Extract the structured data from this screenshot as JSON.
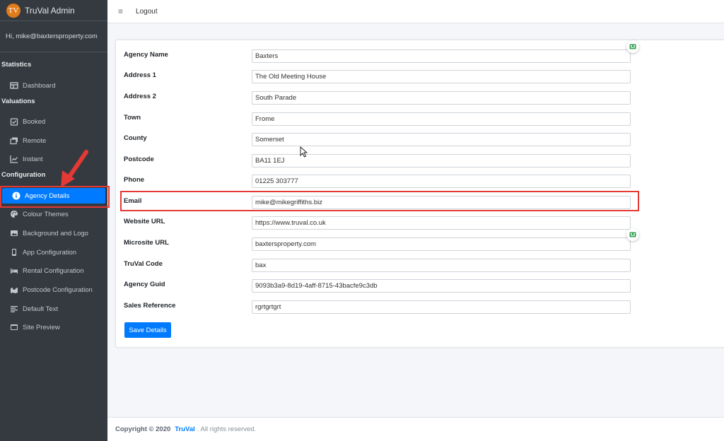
{
  "brand": {
    "logo_text": "TV",
    "title": "TruVal Admin"
  },
  "user": {
    "greeting": "Hi, mike@baxtersproperty.com"
  },
  "sidebar": {
    "headers": {
      "statistics": "Statistics",
      "valuations": "Valuations",
      "configuration": "Configuration"
    },
    "items": {
      "dashboard": "Dashboard",
      "booked": "Booked",
      "remote": "Remote",
      "instant": "Instant",
      "agency_details": "Agency Details",
      "colour_themes": "Colour Themes",
      "background_logo": "Background and Logo",
      "app_configuration": "App Configuration",
      "rental_configuration": "Rental Configuration",
      "postcode_configuration": "Postcode Configuration",
      "default_text": "Default Text",
      "site_preview": "Site Preview"
    }
  },
  "topbar": {
    "menu_icon": "≡",
    "logout": "Logout"
  },
  "form": {
    "fields": [
      {
        "label": "Agency Name",
        "value": "Baxters"
      },
      {
        "label": "Address 1",
        "value": "The Old Meeting House"
      },
      {
        "label": "Address 2",
        "value": "South Parade"
      },
      {
        "label": "Town",
        "value": "Frome"
      },
      {
        "label": "County",
        "value": "Somerset"
      },
      {
        "label": "Postcode",
        "value": "BA11 1EJ"
      },
      {
        "label": "Phone",
        "value": "01225 303777"
      },
      {
        "label": "Email",
        "value": "mike@mikegriffiths.biz"
      },
      {
        "label": "Website URL",
        "value": "https://www.truval.co.uk"
      },
      {
        "label": "Microsite URL",
        "value": "baxtersproperty.com"
      },
      {
        "label": "TruVal Code",
        "value": "bax"
      },
      {
        "label": "Agency Guid",
        "value": "9093b3a9-8d19-4aff-8715-43bacfe9c3db"
      },
      {
        "label": "Sales Reference",
        "value": "rgrtgrtgrt"
      }
    ],
    "save_label": "Save Details"
  },
  "footer": {
    "copyright": "Copyright © 2020",
    "brand": "TruVal",
    "suffix": ". All rights reserved."
  },
  "colors": {
    "accent": "#007bff",
    "highlight": "#e53935",
    "sidebar_bg": "#343a40"
  }
}
